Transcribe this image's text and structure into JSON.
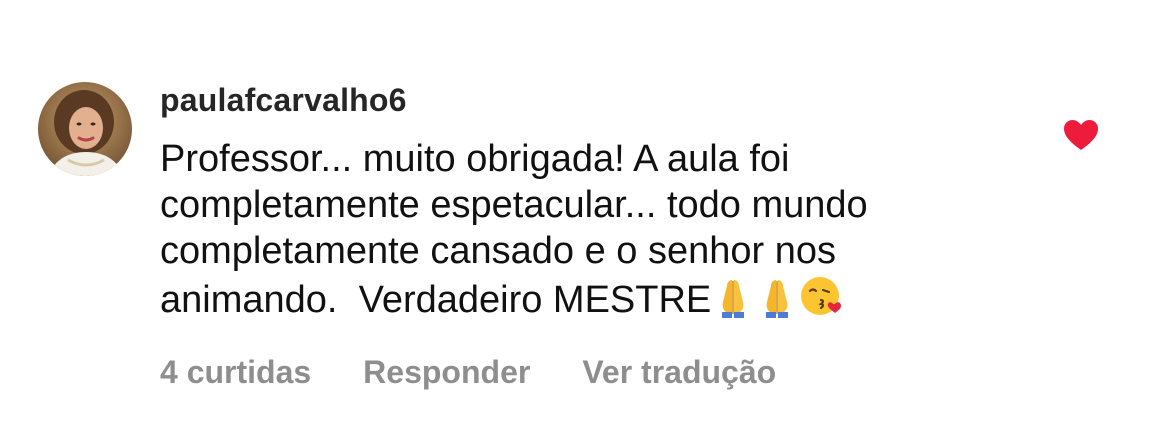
{
  "comment": {
    "username": "paulafcarvalho6",
    "text": "Professor... muito obrigada! A aula foi completamente espetacular... todo mundo completamente cansado e o senhor nos animando.  Verdadeiro MESTRE",
    "emojis": [
      "folded-hands-emoji",
      "folded-hands-emoji",
      "face-blowing-kiss-emoji"
    ],
    "liked": true,
    "like_color": "#ed1c3c"
  },
  "actions": {
    "likes_label": "4 curtidas",
    "reply_label": "Responder",
    "translate_label": "Ver tradução"
  },
  "colors": {
    "text": "#111111",
    "username": "#262626",
    "secondary": "#8e8e8e"
  }
}
